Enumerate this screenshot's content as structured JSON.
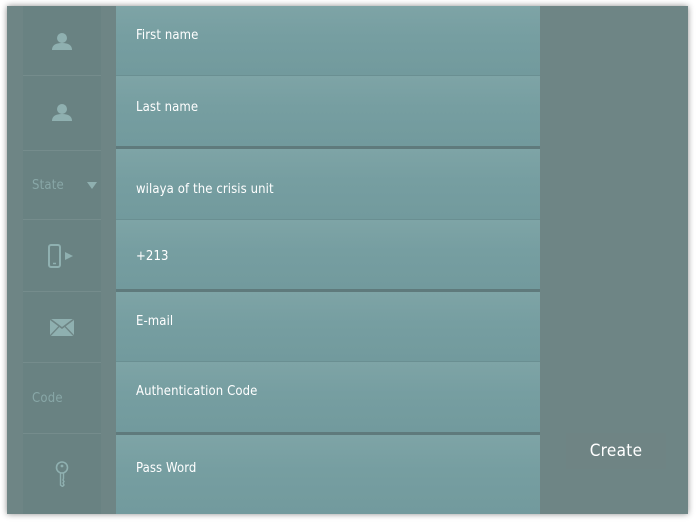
{
  "form": {
    "first_name_label": "First name",
    "last_name_label": "Last name",
    "state_label": "State",
    "wilaya_label": "wilaya of the crisis unit",
    "phone_prefix": "+213",
    "email_label": "E-mail",
    "code_side_label": "Code",
    "auth_code_label": "Authentication Code",
    "password_label": "Pass Word",
    "create_label": "Create"
  },
  "icons": [
    "user-icon",
    "user-icon",
    "chevron-down-icon",
    "mobile-phone-icon",
    "envelope-icon",
    "key-icon"
  ],
  "colors": {
    "frame": "#6e8585",
    "field": "#7ea4a6",
    "icon": "#8fb0b0",
    "text": "#ffffff"
  }
}
